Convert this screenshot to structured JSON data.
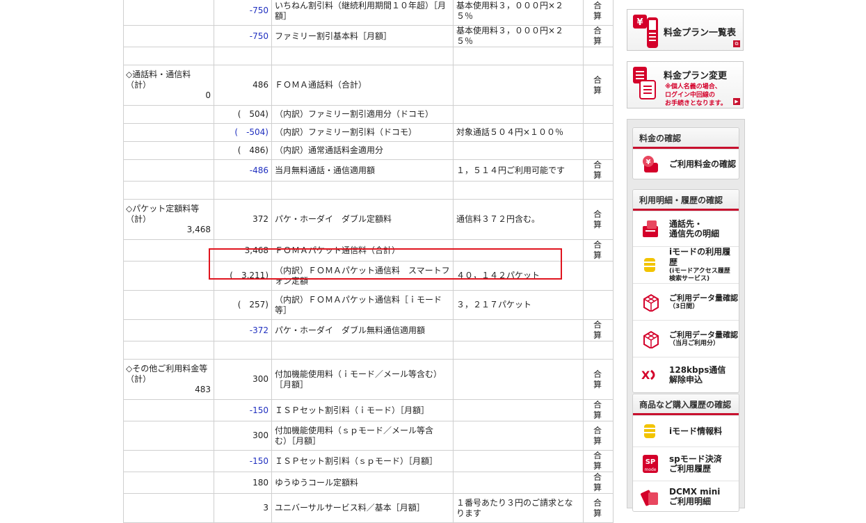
{
  "rows": [
    {
      "h": 42,
      "cat": "",
      "total": "",
      "amount": "-750",
      "neg": true,
      "desc": "いちねん割引料（継続利用期間１０年超）［月額］",
      "note": "基本使用料３，０００円×２５％",
      "kind": "合算"
    },
    {
      "h": 26,
      "cat": "",
      "total": "",
      "amount": "-750",
      "neg": true,
      "desc": "ファミリー割引基本料［月額］",
      "note": "基本使用料３，０００円×２５％",
      "kind": "合算"
    },
    {
      "h": 26,
      "cat": "",
      "total": "",
      "amount": "",
      "neg": false,
      "desc": "",
      "note": "",
      "kind": ""
    },
    {
      "h": 58,
      "cat": "◇通話料・通信料（計）",
      "total": "0",
      "amount": "486",
      "neg": false,
      "desc": "ＦＯＭＡ通話料（合計）",
      "note": "",
      "kind": "合算"
    },
    {
      "h": 26,
      "cat": "",
      "total": "",
      "amount": "(　504)",
      "neg": false,
      "desc": "（内訳）ファミリー割引適用分（ドコモ）",
      "note": "",
      "kind": ""
    },
    {
      "h": 26,
      "cat": "",
      "total": "",
      "amount": "(　-504)",
      "neg": true,
      "desc": "（内訳）ファミリー割引料（ドコモ）",
      "note": "対象通話５０４円×１００％",
      "kind": ""
    },
    {
      "h": 26,
      "cat": "",
      "total": "",
      "amount": "(　486)",
      "neg": false,
      "desc": "（内訳）通常通話料金適用分",
      "note": "",
      "kind": ""
    },
    {
      "h": 26,
      "cat": "",
      "total": "",
      "amount": "-486",
      "neg": true,
      "desc": "当月無料通話・通信適用額",
      "note": "１，５１４円ご利用可能です",
      "kind": "合算"
    },
    {
      "h": 26,
      "cat": "",
      "total": "",
      "amount": "",
      "neg": false,
      "desc": "",
      "note": "",
      "kind": ""
    },
    {
      "h": 58,
      "cat": "◇パケット定額料等（計）",
      "total": "3,468",
      "amount": "372",
      "neg": false,
      "desc": "パケ・ホーダイ　ダブル定額料",
      "note": "通信料３７２円含む。",
      "kind": "合算"
    },
    {
      "h": 26,
      "cat": "",
      "total": "",
      "amount": "3,468",
      "neg": false,
      "desc": "ＦＯＭＡパケット通信料（合計）",
      "note": "",
      "kind": "合算"
    },
    {
      "h": 42,
      "cat": "",
      "total": "",
      "amount": "(　3,211)",
      "neg": false,
      "desc": "（内訳）ＦＯＭＡパケット通信料　スマートフォン定額",
      "note": "４０，１４２パケット",
      "kind": ""
    },
    {
      "h": 42,
      "cat": "",
      "total": "",
      "amount": "(　257)",
      "neg": false,
      "desc": "（内訳）ＦＯＭＡパケット通信料［ｉモード等］",
      "note": "３，２１７パケット",
      "kind": ""
    },
    {
      "h": 26,
      "cat": "",
      "total": "",
      "amount": "-372",
      "neg": true,
      "desc": "パケ・ホーダイ　ダブル無料通信適用額",
      "note": "",
      "kind": "合算"
    },
    {
      "h": 26,
      "cat": "",
      "total": "",
      "amount": "",
      "neg": false,
      "desc": "",
      "note": "",
      "kind": ""
    },
    {
      "h": 58,
      "cat": "◇その他ご利用料金等（計）",
      "total": "483",
      "amount": "300",
      "neg": false,
      "desc": "付加機能使用料（ｉモード／メール等含む）［月額］",
      "note": "",
      "kind": "合算"
    },
    {
      "h": 26,
      "cat": "",
      "total": "",
      "amount": "-150",
      "neg": true,
      "desc": "ＩＳＰセット割引料（ｉモード）［月額］",
      "note": "",
      "kind": "合算"
    },
    {
      "h": 42,
      "cat": "",
      "total": "",
      "amount": "300",
      "neg": false,
      "desc": "付加機能使用料（ｓｐモード／メール等含む）［月額］",
      "note": "",
      "kind": "合算"
    },
    {
      "h": 26,
      "cat": "",
      "total": "",
      "amount": "-150",
      "neg": true,
      "desc": "ＩＳＰセット割引料（ｓｐモード）［月額］",
      "note": "",
      "kind": "合算"
    },
    {
      "h": 26,
      "cat": "",
      "total": "",
      "amount": "180",
      "neg": false,
      "desc": "ゆうゆうコール定額料",
      "note": "",
      "kind": "合算"
    },
    {
      "h": 42,
      "cat": "",
      "total": "",
      "amount": "3",
      "neg": false,
      "desc": "ユニバーサルサービス料／基本［月額］",
      "note": "１番号あたり３円のご請求となります",
      "kind": "合算"
    }
  ],
  "side": {
    "plan_list": {
      "label": "料金プラン一覧表",
      "icon": "yen-phone-icon"
    },
    "plan_change": {
      "label": "料金プラン変更",
      "note": "※個人名義の場合、\nログイン中回線の\nお手続きとなります。",
      "icon": "document-icon"
    },
    "sections": [
      {
        "header": "料金の確認",
        "items": [
          {
            "label": "ご利用料金の確認",
            "icon": "yen-coin-icon"
          }
        ]
      },
      {
        "header": "利用明細・履歴の確認",
        "items": [
          {
            "label": "通話先・\n通信先の明細",
            "icon": "statement-icon"
          },
          {
            "label": "iモードの利用履歴",
            "sub": "(iモードアクセス履歴\n 検索サービス)",
            "icon": "coin-stack-icon"
          },
          {
            "label": "ご利用データ量確認",
            "sub": "（3日間）",
            "icon": "data-cube-icon"
          },
          {
            "label": "ご利用データ量確認",
            "sub": "（当月ご利用分）",
            "icon": "data-cube-icon"
          },
          {
            "label": "128kbps通信\n解除申込",
            "icon": "xi-logo-icon"
          }
        ]
      },
      {
        "header": "商品など購入履歴の確認",
        "items": [
          {
            "label": "iモード情報料",
            "icon": "coin-stack-icon"
          },
          {
            "label": "spモード決済\nご利用履歴",
            "icon": "sp-mode-icon"
          },
          {
            "label": "DCMX mini\nご利用明細",
            "icon": "dcmx-card-icon"
          }
        ]
      }
    ]
  }
}
